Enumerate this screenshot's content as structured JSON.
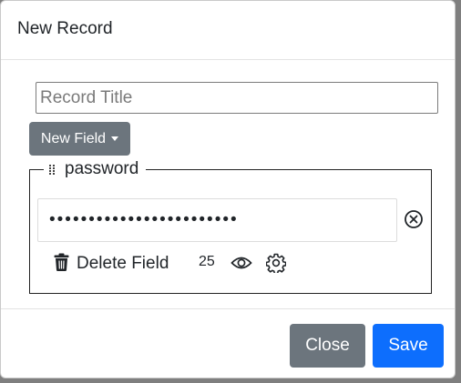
{
  "modal": {
    "title": "New Record"
  },
  "record_title": {
    "value": "",
    "placeholder": "Record Title"
  },
  "new_field_button": {
    "label": "New Field"
  },
  "field": {
    "label": "password",
    "value": "••••••••••••••••••••••••",
    "length": "25",
    "delete_label": "Delete Field"
  },
  "footer": {
    "close_label": "Close",
    "save_label": "Save"
  },
  "colors": {
    "secondary": "#6c757d",
    "primary": "#0d6efd"
  },
  "icons": [
    "grip-vertical-icon",
    "clear-circle-x-icon",
    "trash-icon",
    "eye-icon",
    "gear-icon",
    "caret-down-icon"
  ]
}
